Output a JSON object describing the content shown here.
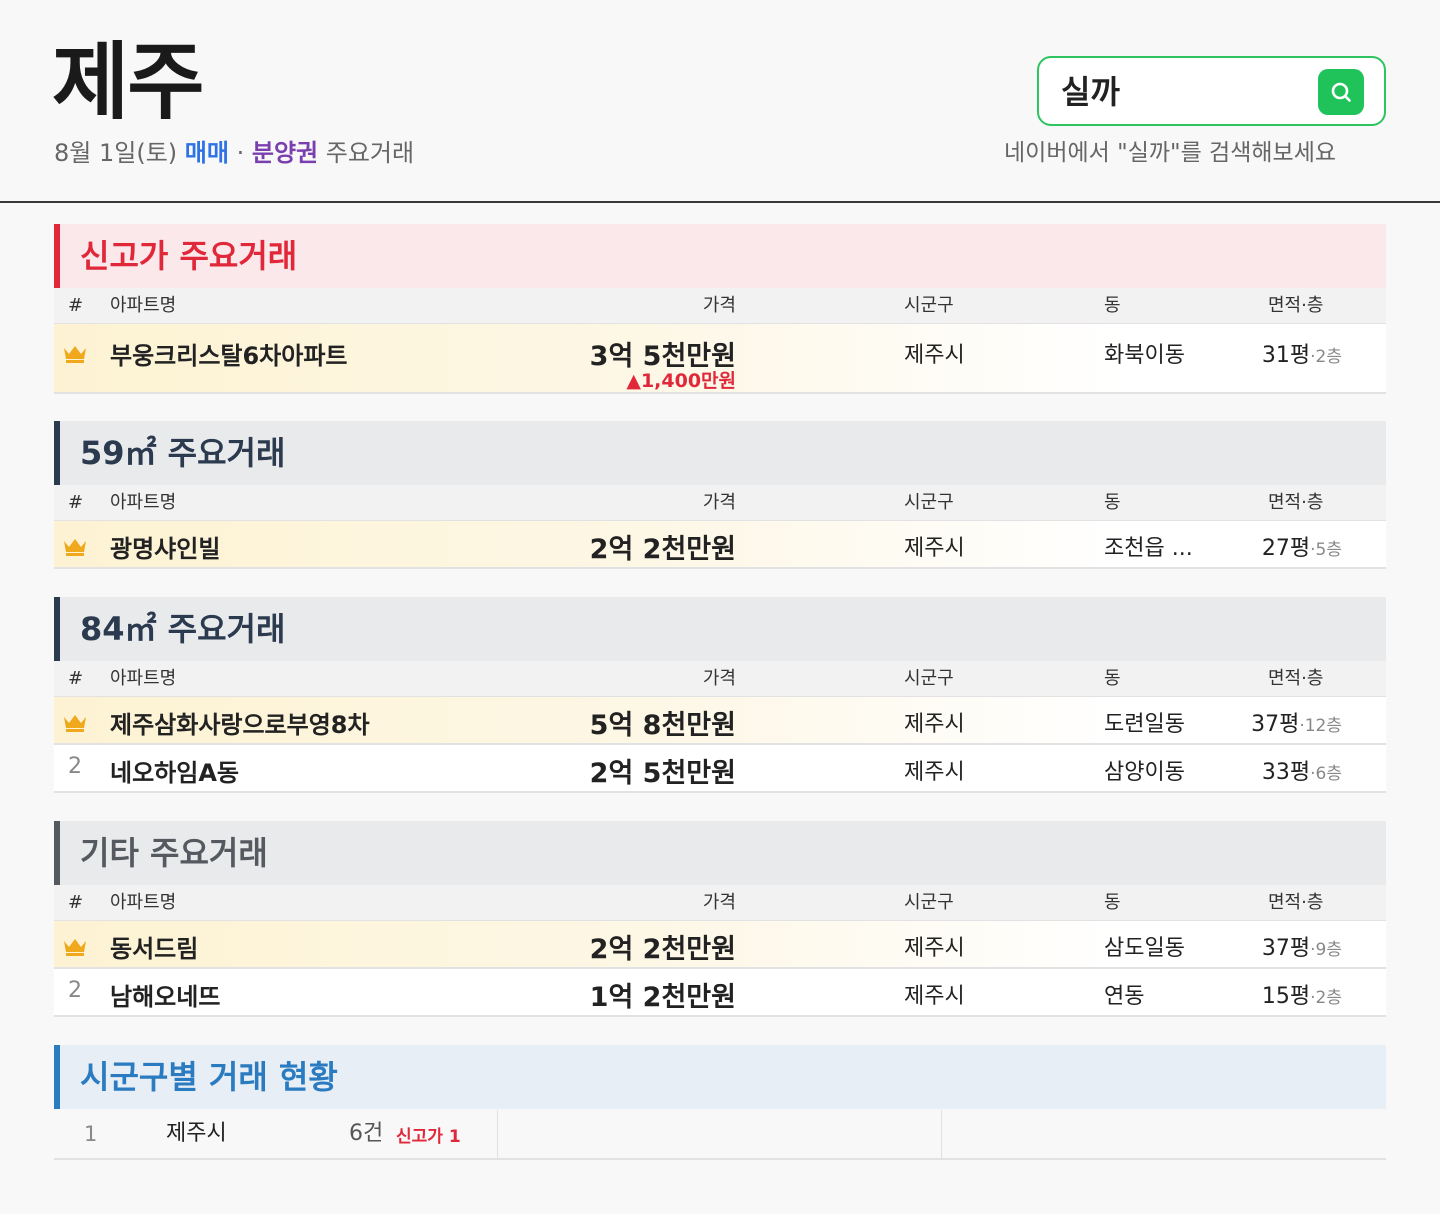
{
  "header": {
    "title": "제주",
    "date": "8월 1일(토)",
    "trade_type_sale": "매매",
    "separator": "·",
    "trade_type_presale": "분양권",
    "suffix": "주요거래"
  },
  "search": {
    "query": "실까",
    "hint": "네이버에서 \"실까\"를 검색해보세요",
    "icon": "search-icon"
  },
  "columns": {
    "rank": "#",
    "name": "아파트명",
    "price": "가격",
    "sigungu": "시군구",
    "dong": "동",
    "area": "면적·층"
  },
  "sections": [
    {
      "title": "신고가 주요거래",
      "rows": [
        {
          "rank": "crown",
          "name": "부웅크리스탈6차아파트",
          "price": "3억 5천만원",
          "delta": "▲1,400만원",
          "sigungu": "제주시",
          "dong": "화북이동",
          "area": "31평",
          "floor": "·2층"
        }
      ]
    },
    {
      "title": "59㎡ 주요거래",
      "rows": [
        {
          "rank": "crown",
          "name": "광명샤인빌",
          "price": "2억 2천만원",
          "sigungu": "제주시",
          "dong": "조천읍 ...",
          "area": "27평",
          "floor": "·5층"
        }
      ]
    },
    {
      "title": "84㎡ 주요거래",
      "rows": [
        {
          "rank": "crown",
          "name": "제주삼화사랑으로부영8차",
          "price": "5억 8천만원",
          "sigungu": "제주시",
          "dong": "도련일동",
          "area": "37평",
          "floor": "·12층"
        },
        {
          "rank": "2",
          "name": "네오하임A동",
          "price": "2억 5천만원",
          "sigungu": "제주시",
          "dong": "삼양이동",
          "area": "33평",
          "floor": "·6층"
        }
      ]
    },
    {
      "title": "기타 주요거래",
      "rows": [
        {
          "rank": "crown",
          "name": "동서드림",
          "price": "2억 2천만원",
          "sigungu": "제주시",
          "dong": "삼도일동",
          "area": "37평",
          "floor": "·9층"
        },
        {
          "rank": "2",
          "name": "남해오네뜨",
          "price": "1억 2천만원",
          "sigungu": "제주시",
          "dong": "연동",
          "area": "15평",
          "floor": "·2층"
        }
      ]
    }
  ],
  "district": {
    "title": "시군구별 거래 현황",
    "rows": [
      {
        "rank": "1",
        "name": "제주시",
        "count": "6건",
        "record_label": "신고가 1"
      }
    ]
  },
  "colors": {
    "record_high": "#e0283a",
    "m59": "#2b3a4f",
    "m84": "#2b3a4f",
    "other": "#555a60",
    "district": "#2a7bc0",
    "search_green": "#1fc35a",
    "sale_blue": "#2e72e6",
    "presale_purple": "#7a3fae"
  }
}
